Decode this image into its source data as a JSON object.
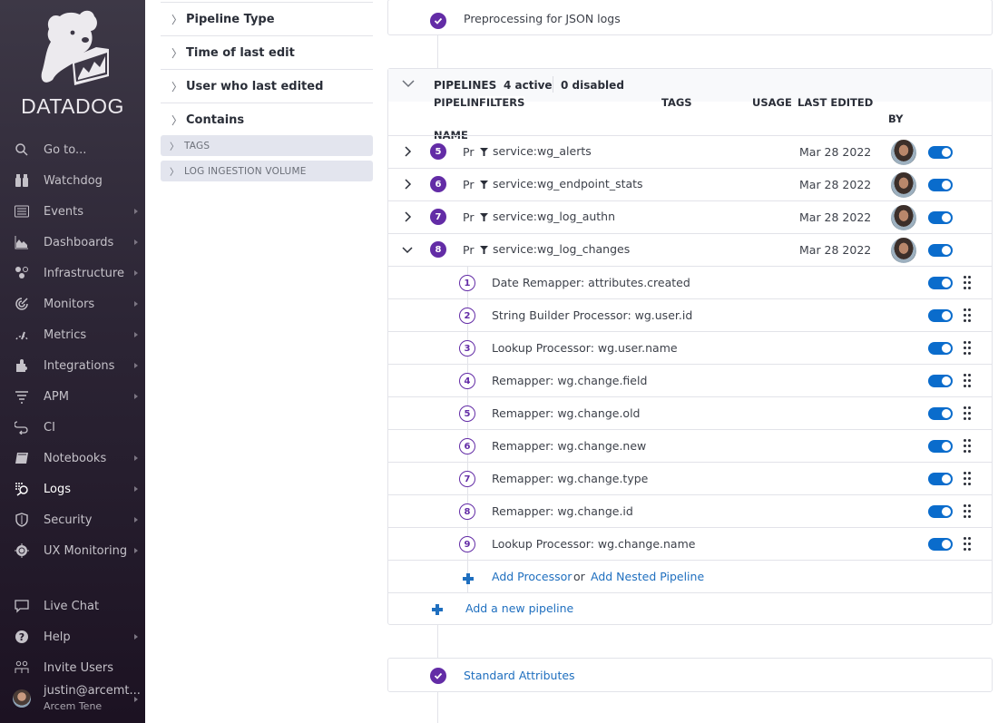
{
  "app": {
    "brand": "DATADOG",
    "accent_color": "#632ca6",
    "link_color": "#1f6fbf",
    "toggle_color": "#0a6ccc"
  },
  "sidebar": {
    "items": [
      {
        "label": "Go to...",
        "icon": "search-icon",
        "has_arrow": false
      },
      {
        "label": "Watchdog",
        "icon": "binoculars-icon",
        "has_arrow": false
      },
      {
        "label": "Events",
        "icon": "events-icon",
        "has_arrow": true
      },
      {
        "label": "Dashboards",
        "icon": "dashboards-icon",
        "has_arrow": true
      },
      {
        "label": "Infrastructure",
        "icon": "infrastructure-icon",
        "has_arrow": true
      },
      {
        "label": "Monitors",
        "icon": "monitors-icon",
        "has_arrow": true
      },
      {
        "label": "Metrics",
        "icon": "metrics-icon",
        "has_arrow": true
      },
      {
        "label": "Integrations",
        "icon": "puzzle-icon",
        "has_arrow": true
      },
      {
        "label": "APM",
        "icon": "apm-icon",
        "has_arrow": true
      },
      {
        "label": "CI",
        "icon": "ci-icon",
        "has_arrow": false
      },
      {
        "label": "Notebooks",
        "icon": "notebook-icon",
        "has_arrow": true
      },
      {
        "label": "Logs",
        "icon": "logs-icon",
        "has_arrow": true,
        "active": true
      },
      {
        "label": "Security",
        "icon": "shield-icon",
        "has_arrow": true
      },
      {
        "label": "UX Monitoring",
        "icon": "ux-monitoring-icon",
        "has_arrow": true
      }
    ],
    "bottom_items": [
      {
        "label": "Live Chat",
        "icon": "chat-icon",
        "has_arrow": false
      },
      {
        "label": "Help",
        "icon": "help-icon",
        "has_arrow": true
      },
      {
        "label": "Invite Users",
        "icon": "invite-users-icon",
        "has_arrow": false
      }
    ],
    "user": {
      "email": "justin@arcemt...",
      "org": "Arcem Tene"
    }
  },
  "filters": {
    "facets": [
      "Pipeline Type",
      "Time of last edit",
      "User who last edited",
      "Contains"
    ],
    "groups": [
      "TAGS",
      "LOG INGESTION VOLUME"
    ]
  },
  "main": {
    "preprocessing": {
      "title": "Preprocessing for JSON logs"
    },
    "pipelines": {
      "header": {
        "label": "PIPELINES",
        "active": "4 active",
        "disabled": "0 disabled"
      },
      "columns": {
        "pipeline_name_1": "PIPELINE",
        "pipeline_name_2": "NAME",
        "filters": "FILTERS",
        "tags": "TAGS",
        "usage": "USAGE",
        "last_edited": "LAST EDITED",
        "by": "BY"
      },
      "rows": [
        {
          "num": "5",
          "name": "Pr",
          "filter": "service:wg_alerts",
          "date": "Mar 28 2022",
          "enabled": true,
          "expanded": false
        },
        {
          "num": "6",
          "name": "Pr",
          "filter": "service:wg_endpoint_stats",
          "date": "Mar 28 2022",
          "enabled": true,
          "expanded": false
        },
        {
          "num": "7",
          "name": "Pr",
          "filter": "service:wg_log_authn",
          "date": "Mar 28 2022",
          "enabled": true,
          "expanded": false
        },
        {
          "num": "8",
          "name": "Pr",
          "filter": "service:wg_log_changes",
          "date": "Mar 28 2022",
          "enabled": true,
          "expanded": true
        }
      ],
      "processors": [
        {
          "num": "1",
          "name": "Date Remapper: attributes.created",
          "enabled": true
        },
        {
          "num": "2",
          "name": "String Builder Processor: wg.user.id",
          "enabled": true
        },
        {
          "num": "3",
          "name": "Lookup Processor: wg.user.name",
          "enabled": true
        },
        {
          "num": "4",
          "name": "Remapper: wg.change.field",
          "enabled": true
        },
        {
          "num": "5",
          "name": "Remapper: wg.change.old",
          "enabled": true
        },
        {
          "num": "6",
          "name": "Remapper: wg.change.new",
          "enabled": true
        },
        {
          "num": "7",
          "name": "Remapper: wg.change.type",
          "enabled": true
        },
        {
          "num": "8",
          "name": "Remapper: wg.change.id",
          "enabled": true
        },
        {
          "num": "9",
          "name": "Lookup Processor: wg.change.name",
          "enabled": true
        }
      ],
      "add_processor": "Add Processor",
      "or": "or",
      "add_nested": "Add Nested Pipeline",
      "add_pipeline": "Add a new pipeline"
    },
    "standard_attributes": {
      "title": "Standard Attributes"
    }
  }
}
